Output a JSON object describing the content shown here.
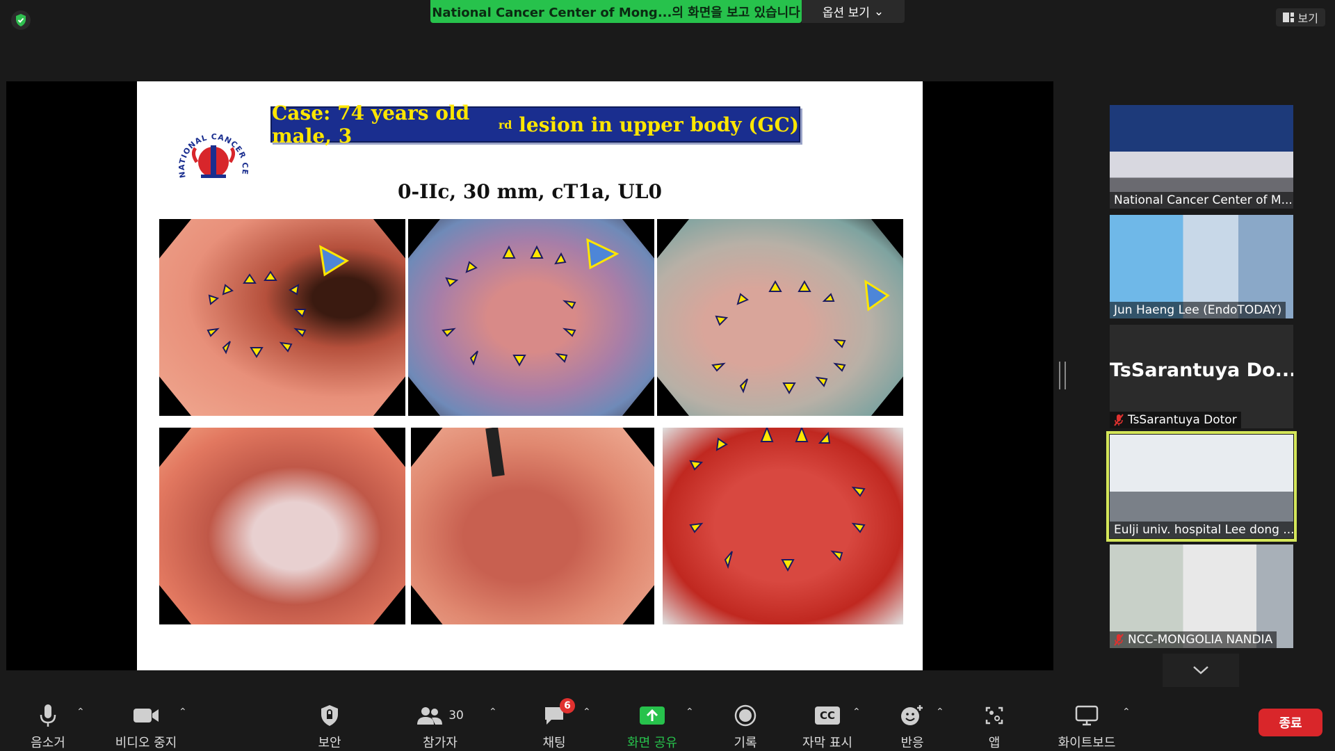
{
  "banner": {
    "sharing_text": "National Cancer Center of Mong...의 화면을 보고 있습니다",
    "view_options_label": "옵션 보기",
    "view_label": "보기"
  },
  "slide": {
    "title_main": "Case: 74 years old male, 3",
    "title_sup": "rd",
    "title_tail": " lesion in upper body (GC)",
    "subtitle": "0-IIc, 30 mm, cT1a, UL0",
    "logo_text": "NATIONAL CANCER CENTER OF MONGOLIA"
  },
  "participants": [
    {
      "name": "National Cancer Center of M...",
      "muted": false
    },
    {
      "name": "Jun Haeng Lee (EndoTODAY)",
      "muted": false
    },
    {
      "name": "TsSarantuya Dotor",
      "display_name": "TsSarantuya   Do...",
      "muted": true
    },
    {
      "name": "Eulji univ. hospital Lee dong ...",
      "muted": false,
      "active_speaker": true
    },
    {
      "name": "NCC-MONGOLIA NANDIA",
      "muted": true
    }
  ],
  "toolbar": {
    "mute": "음소거",
    "video": "비디오 중지",
    "security": "보안",
    "participants": "참가자",
    "participants_count": "30",
    "chat": "채팅",
    "chat_badge": "6",
    "share": "화면 공유",
    "record": "기록",
    "captions": "자막 표시",
    "captions_icon": "CC",
    "reactions": "반응",
    "apps": "앱",
    "whiteboard": "화이트보드",
    "end": "종료"
  },
  "colors": {
    "share_green": "#27c24c",
    "end_red": "#d9262a",
    "active_outline": "#d4e65a",
    "title_blue": "#1a2e8f",
    "title_yellow": "#ffe600"
  }
}
